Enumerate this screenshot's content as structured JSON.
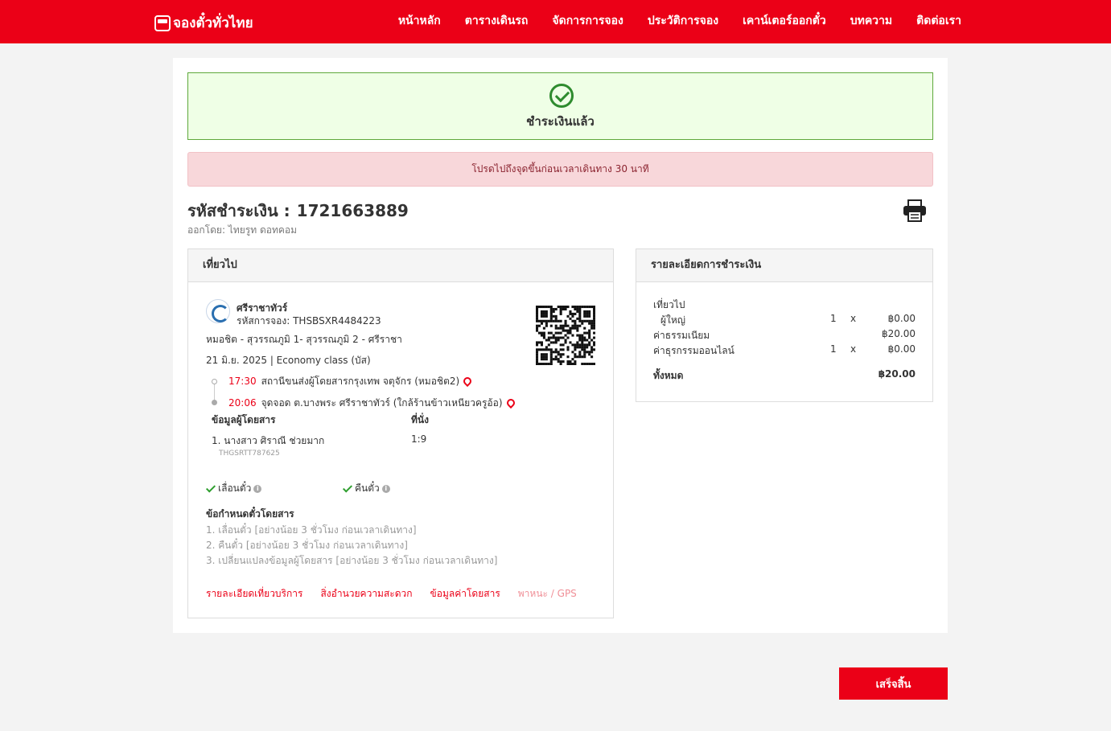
{
  "header": {
    "logo_text": "จองตั๋วทั่วไทย",
    "nav": [
      "หน้าหลัก",
      "ตารางเดินรถ",
      "จัดการการจอง",
      "ประวัติการจอง",
      "เคาน์เตอร์ออกตั๋ว",
      "บทความ",
      "ติดต่อเรา"
    ]
  },
  "status": {
    "success_text": "ชำระเงินแล้ว",
    "warning_text": "โปรดไปถึงจุดขึ้นก่อนเวลาเดินทาง 30 นาที"
  },
  "payment": {
    "code_label": "รหัสชำระเงิน :",
    "code": "1721663889",
    "issuer": "ออกโดย: ไทยรูท ดอทคอม"
  },
  "trip": {
    "header": "เที่ยวไป",
    "operator": "ศรีราชาทัวร์",
    "booking_code": "รหัสการจอง: THSBSXR4484223",
    "route": "หมอชิต - สุวรรณภูมิ 1- สุวรรณภูมิ 2 - ศรีราชา",
    "date_line": "21 มิ.ย. 2025  |  Economy class (บัส)",
    "stops": [
      {
        "time": "17:30",
        "place": "สถานีขนส่งผู้โดยสารกรุงเทพ จตุจักร (หมอชิต2)"
      },
      {
        "time": "20:06",
        "place": "จุดจอด ต.บางพระ ศรีราชาทัวร์ (ใกล้ร้านข้าวเหนียวครูอ้อ)"
      }
    ],
    "passenger_header": "ข้อมูลผู้โดยสาร",
    "seat_header": "ที่นั่ง",
    "passenger_name": "1. นางสาว ศิราณี ช่วยมาก",
    "passenger_id": "THGSRTT787625",
    "seat": "1:9",
    "features": [
      "เลื่อนตั๋ว",
      "คืนตั๋ว"
    ],
    "rules_header": "ข้อกำหนดตั๋วโดยสาร",
    "rules": [
      "1. เลื่อนตั๋ว [อย่างน้อย 3 ชั่วโมง ก่อนเวลาเดินทาง]",
      "2. คืนตั๋ว [อย่างน้อย 3 ชั่วโมง ก่อนเวลาเดินทาง]",
      "3. เปลี่ยนแปลงข้อมูลผู้โดยสาร [อย่างน้อย 3 ชั่วโมง ก่อนเวลาเดินทาง]"
    ],
    "links": [
      "รายละเอียดเที่ยวบริการ",
      "สิ่งอำนวยความสะดวก",
      "ข้อมูลค่าโดยสาร",
      "พาหนะ / GPS"
    ]
  },
  "payment_detail": {
    "header": "รายละเอียดการชำระเงิน",
    "section": "เที่ยวไป",
    "rows": [
      {
        "label": "ผู้ใหญ่",
        "qty": "1",
        "x": "x",
        "amount": "฿0.00"
      },
      {
        "label": "ค่าธรรมเนียม",
        "qty": "",
        "x": "",
        "amount": "฿20.00"
      },
      {
        "label": "ค่าธุรกรรมออนไลน์",
        "qty": "1",
        "x": "x",
        "amount": "฿0.00"
      }
    ],
    "total_label": "ทั้งหมด",
    "total": "฿20.00"
  },
  "footer": {
    "finish_label": "เสร็จสิ้น"
  },
  "colors": {
    "brand_red": "#eb0017",
    "success_green": "#2e8b2e"
  }
}
